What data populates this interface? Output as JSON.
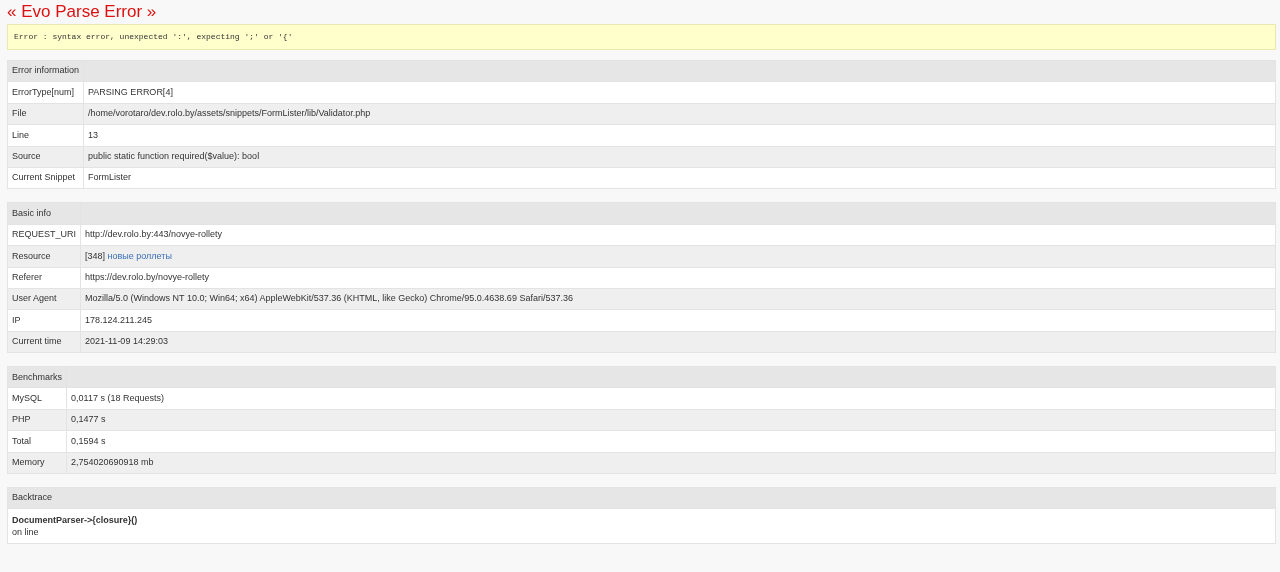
{
  "title": "« Evo Parse Error »",
  "error_message": "Error : syntax error, unexpected ':', expecting ';' or '{'",
  "sections": [
    {
      "heading": "Error information",
      "rows": [
        {
          "label": "ErrorType[num]",
          "value": "PARSING ERROR[4]"
        },
        {
          "label": "File",
          "value": "/home/vorotaro/dev.rolo.by/assets/snippets/FormLister/lib/Validator.php"
        },
        {
          "label": "Line",
          "value": "13"
        },
        {
          "label": "Source",
          "value": "public static function required($value): bool"
        },
        {
          "label": "Current Snippet",
          "value": "FormLister"
        }
      ]
    },
    {
      "heading": "Basic info",
      "rows": [
        {
          "label": "REQUEST_URI",
          "value": "http://dev.rolo.by:443/novye-rollety"
        },
        {
          "label": "Resource",
          "value": "[348]",
          "link": "новые роллеты"
        },
        {
          "label": "Referer",
          "value": "https://dev.rolo.by/novye-rollety"
        },
        {
          "label": "User Agent",
          "value": "Mozilla/5.0 (Windows NT 10.0; Win64; x64) AppleWebKit/537.36 (KHTML, like Gecko) Chrome/95.0.4638.69 Safari/537.36"
        },
        {
          "label": "IP",
          "value": "178.124.211.245"
        },
        {
          "label": "Current time",
          "value": "2021-11-09 14:29:03"
        }
      ]
    },
    {
      "heading": "Benchmarks",
      "rows": [
        {
          "label": "MySQL",
          "value": "0,0117 s (18 Requests)"
        },
        {
          "label": "PHP",
          "value": "0,1477 s"
        },
        {
          "label": "Total",
          "value": "0,1594 s"
        },
        {
          "label": "Memory",
          "value": "2,754020690918 mb"
        }
      ]
    }
  ],
  "backtrace": {
    "heading": "Backtrace",
    "call": "DocumentParser->{closure}()",
    "location": "on line"
  }
}
